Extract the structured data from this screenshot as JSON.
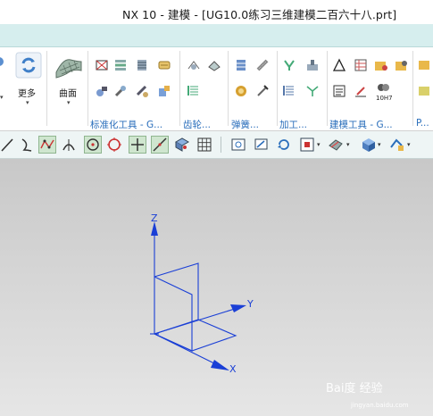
{
  "window": {
    "title": "NX 10 - 建模 - [UG10.0练习三维建模二百六十八.prt]"
  },
  "ribbon": {
    "more_label": "更多",
    "surface_label": "曲面",
    "groups": [
      "标准化工具 - G...",
      "齿轮...",
      "弹簧...",
      "加工...",
      "建模工具 - G...",
      "P..."
    ],
    "toolbox_badge": "10H7"
  },
  "viewport": {
    "axis_z": "Z",
    "axis_y": "Y",
    "axis_x": "X",
    "triad_color": "#1a3fd6"
  },
  "watermark": {
    "brand": "Bai度 经验",
    "url": "jingyan.baidu.com"
  },
  "colors": {
    "tab_band": "#d6eeee",
    "group_label": "#2a6ebb",
    "viewport_bg": "#d4d4d4"
  }
}
